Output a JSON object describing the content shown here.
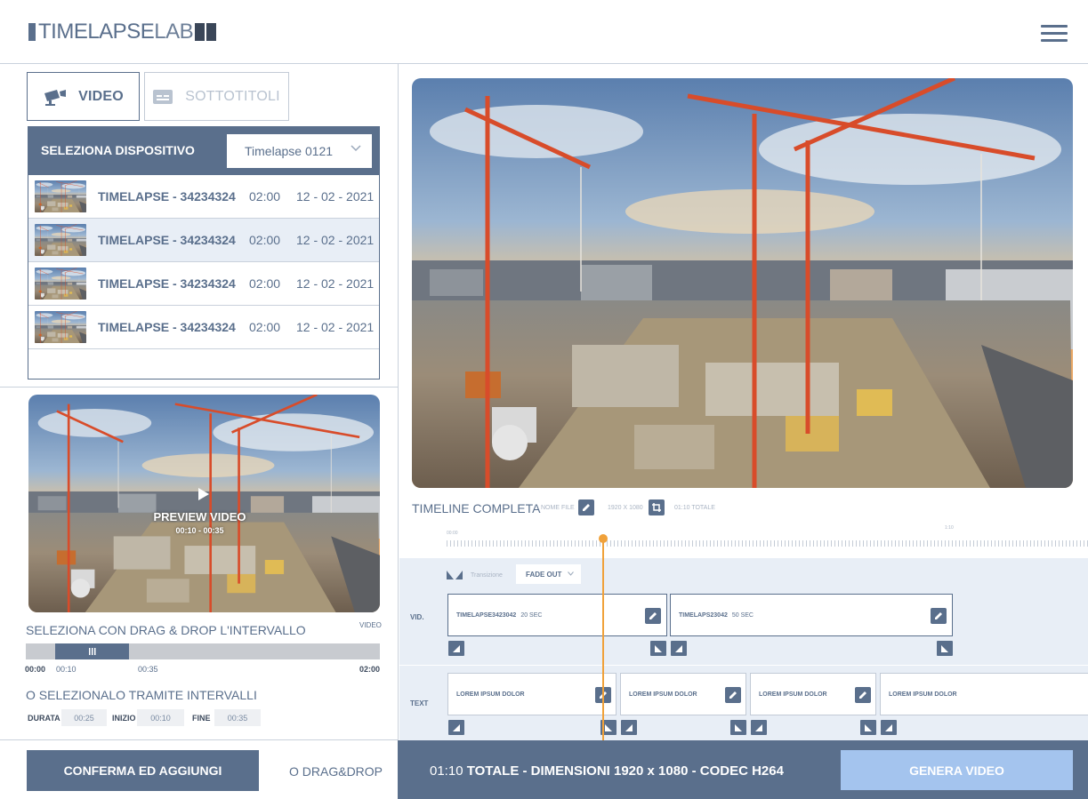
{
  "app": {
    "logo_part1": "TIMELAPSE",
    "logo_part2": "LAB"
  },
  "header": {
    "menu_icon": "hamburger-icon"
  },
  "tabs": [
    {
      "label": "VIDEO",
      "icon": "camera-icon",
      "active": true
    },
    {
      "label": "SOTTOTITOLI",
      "icon": "subtitles-icon",
      "active": false
    }
  ],
  "device": {
    "label": "SELEZIONA DISPOSITIVO",
    "selected": "Timelapse 0121"
  },
  "list": [
    {
      "name": "TIMELAPSE - 34234324",
      "duration": "02:00",
      "date": "12 - 02 - 2021"
    },
    {
      "name": "TIMELAPSE - 34234324",
      "duration": "02:00",
      "date": "12 - 02 - 2021"
    },
    {
      "name": "TIMELAPSE - 34234324",
      "duration": "02:00",
      "date": "12 - 02 - 2021"
    },
    {
      "name": "TIMELAPSE - 34234324",
      "duration": "02:00",
      "date": "12 - 02 - 2021"
    }
  ],
  "preview": {
    "label": "PREVIEW VIDEO",
    "range": "00:10 - 00:35"
  },
  "dragdrop": {
    "label": "SELEZIONA CON DRAG & DROP L'INTERVALLO",
    "tag": "VIDEO",
    "range_start": "00:00",
    "sel_start": "00:10",
    "sel_end": "00:35",
    "range_end": "02:00",
    "selection_fraction_start": 0.083,
    "selection_fraction_end": 0.292
  },
  "intervals": {
    "label": "O SELEZIONALO TRAMITE INTERVALLI",
    "durata_label": "DURATA",
    "durata_value": "00:25",
    "inizio_label": "INIZIO",
    "inizio_value": "00:10",
    "fine_label": "FINE",
    "fine_value": "00:35"
  },
  "left_footer": {
    "confirm": "CONFERMA ED AGGIUNGI",
    "dd_link": "O DRAG&DROP"
  },
  "timeline": {
    "title": "TIMELINE COMPLETA",
    "nome_file": "NOME FILE",
    "resolution": "1920 X 1080",
    "total": "01:10 TOTALE",
    "ruler_start": "00:00",
    "ruler_mark": "1:10",
    "transition_label": "Transizione",
    "transition_value": "FADE OUT",
    "vid_label": "VID.",
    "text_label": "TEXT",
    "video_clips": [
      {
        "name": "TIMELAPSE3423042",
        "duration": "20 SEC"
      },
      {
        "name": "TIMELAPS23042",
        "duration": "50 SEC"
      }
    ],
    "text_clips": [
      {
        "name": "LOREM IPSUM DOLOR"
      },
      {
        "name": "LOREM IPSUM DOLOR"
      },
      {
        "name": "LOREM IPSUM DOLOR"
      },
      {
        "name": "LOREM IPSUM DOLOR"
      }
    ]
  },
  "footer": {
    "time": "01:10",
    "summary": "TOTALE - DIMENSIONI 1920 x 1080 - CODEC H264",
    "generate": "GENERA VIDEO"
  },
  "colors": {
    "primary": "#5a6f8c",
    "accent": "#f0a13a",
    "generate_button": "#a4c4ee",
    "track_bg": "#e8eef6"
  }
}
